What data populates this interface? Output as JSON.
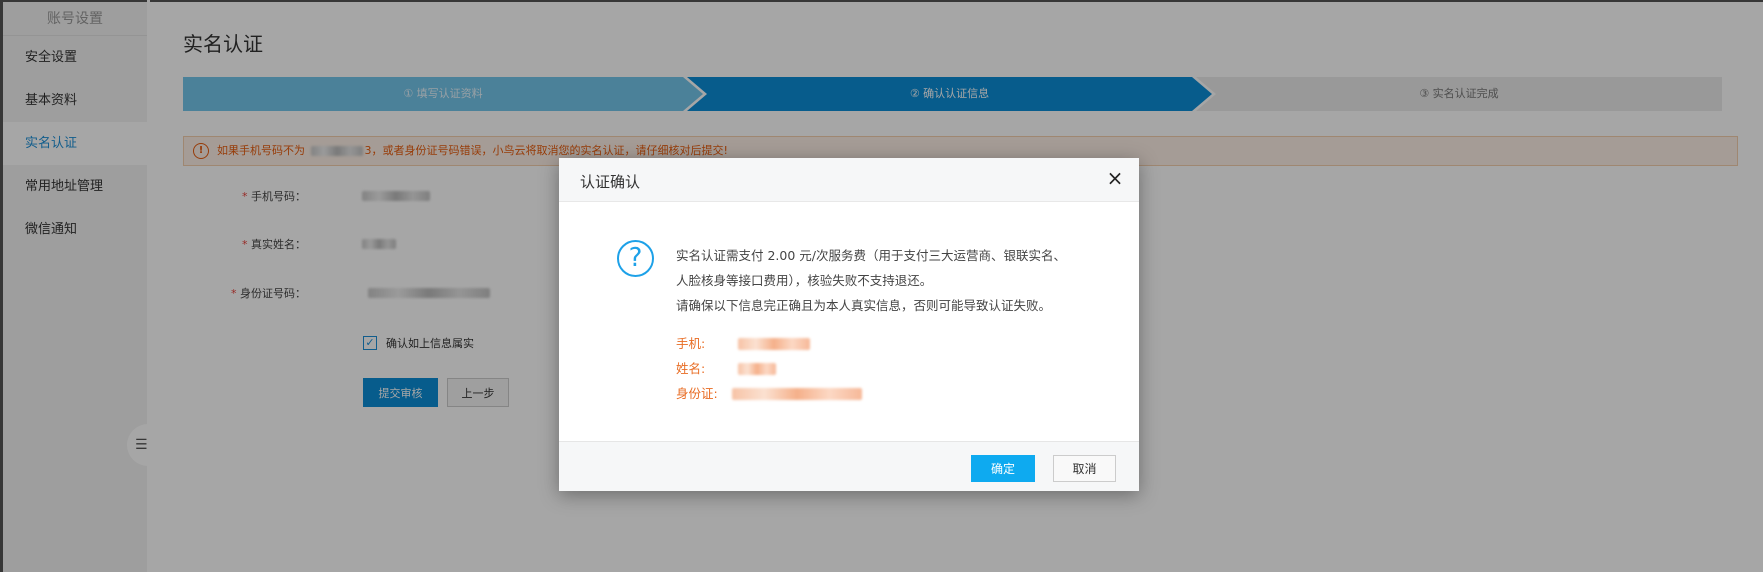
{
  "sidebar": {
    "title": "账号设置",
    "items": [
      {
        "label": "安全设置"
      },
      {
        "label": "基本资料"
      },
      {
        "label": "实名认证"
      },
      {
        "label": "常用地址管理"
      },
      {
        "label": "微信通知"
      }
    ],
    "active_index": 2,
    "collapse_icon": "list-icon"
  },
  "main": {
    "title": "实名认证",
    "steps": [
      {
        "label": "① 填写认证资料"
      },
      {
        "label": "② 确认认证信息"
      },
      {
        "label": "③ 实名认证完成"
      }
    ],
    "warning": {
      "icon": "exclamation-icon",
      "prefix": "如果手机号码不为",
      "phone_tail": "3",
      "suffix": "，或者身份证号码错误，小鸟云将取消您的实名认证，请仔细核对后提交!"
    },
    "form": {
      "phone_label": "手机号码：",
      "name_label": "真实姓名：",
      "id_label": "身份证号码：",
      "confirm_label": "确认如上信息属实"
    },
    "submit_label": "提交审核",
    "prev_label": "上一步"
  },
  "modal": {
    "title": "认证确认",
    "close_icon": "close-icon",
    "question_icon": "question-circle-icon",
    "desc_line1": "实名认证需支付 2.00 元/次服务费（用于支付三大运营商、银联实名、",
    "desc_line2": "人脸核身等接口费用），核验失败不支持退还。",
    "desc_line3": "请确保以下信息完正确且为本人真实信息，否则可能导致认证失败。",
    "phone_label": "手机:",
    "name_label": "姓名:",
    "id_label": "身份证:",
    "ok_label": "确定",
    "cancel_label": "取消"
  },
  "colors": {
    "primary": "#0b8ed8",
    "ok_button": "#0eaaf0",
    "warning": "#e85c0e",
    "info_text": "#e86c23"
  }
}
